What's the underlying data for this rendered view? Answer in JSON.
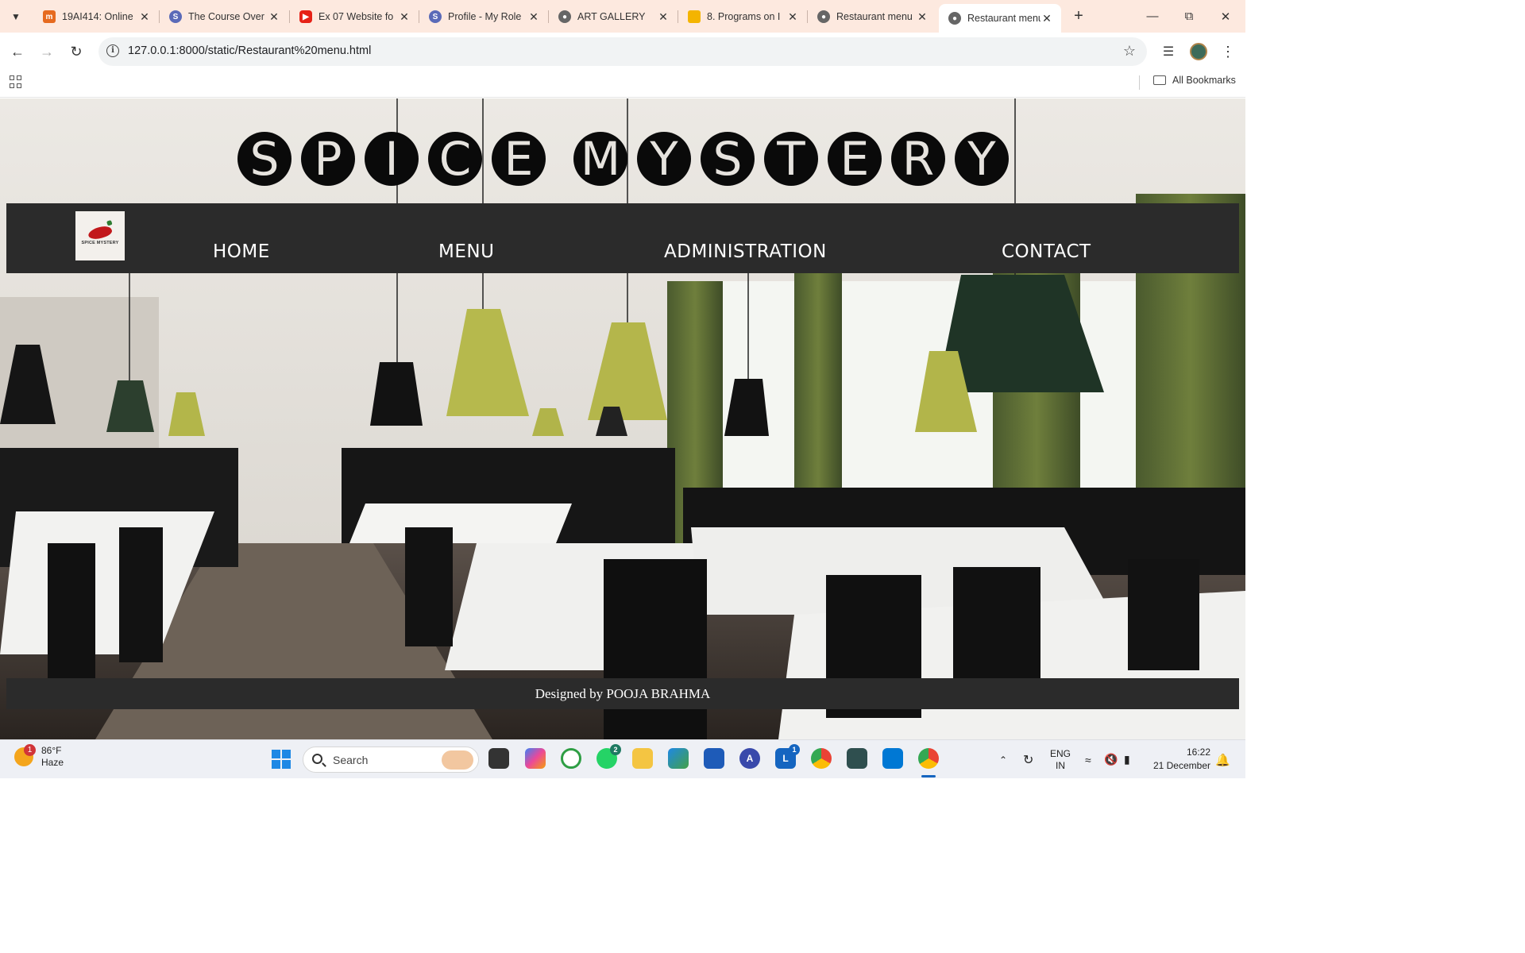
{
  "browser": {
    "tabs": [
      {
        "title": "19AI414: Online",
        "favicon": "moodle-icon",
        "color": "#e66a1f",
        "active": false
      },
      {
        "title": "The Course Over",
        "favicon": "course-icon",
        "color": "#5a6ab8",
        "active": false
      },
      {
        "title": "Ex 07 Website fo",
        "favicon": "youtube-icon",
        "color": "#e62117",
        "active": false
      },
      {
        "title": "Profile - My Role",
        "favicon": "profile-icon",
        "color": "#5a6ab8",
        "active": false
      },
      {
        "title": "ART GALLERY",
        "favicon": "globe-icon",
        "color": "#666666",
        "active": false
      },
      {
        "title": "8. Programs on I",
        "favicon": "slides-icon",
        "color": "#f4b400",
        "active": false
      },
      {
        "title": "Restaurant menu",
        "favicon": "globe-icon",
        "color": "#666666",
        "active": false
      },
      {
        "title": "Restaurant menu",
        "favicon": "globe-icon",
        "color": "#666666",
        "active": true
      }
    ],
    "url": "127.0.0.1:8000/static/Restaurant%20menu.html",
    "bookmarks_label": "All Bookmarks"
  },
  "page": {
    "title_words": [
      {
        "letters": [
          "S",
          "P",
          "I",
          "C",
          "E"
        ]
      },
      {
        "letters": [
          "M",
          "Y",
          "S",
          "T",
          "E",
          "R",
          "Y"
        ]
      }
    ],
    "logo_text": "SPICE MYSTERY",
    "nav": [
      "HOME",
      "MENU",
      "ADMINISTRATION",
      "CONTACT"
    ],
    "footer": "Designed by POOJA BRAHMA"
  },
  "taskbar": {
    "weather_temp": "86°F",
    "weather_desc": "Haze",
    "weather_badge": "1",
    "search_placeholder": "Search",
    "whatsapp_badge": "2",
    "lync_badge": "1",
    "language": "ENG",
    "region": "IN",
    "time": "16:22",
    "date": "21 December"
  }
}
